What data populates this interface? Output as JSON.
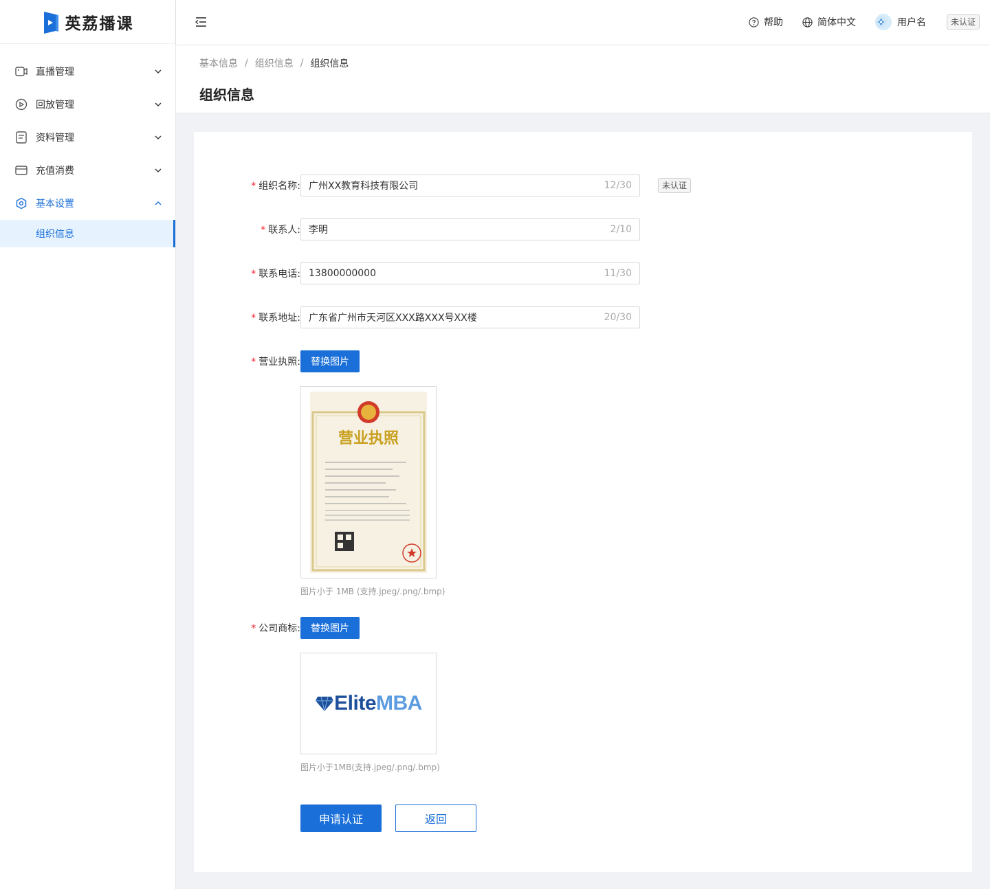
{
  "brand": {
    "name": "英荔播课"
  },
  "sidebar": {
    "items": [
      {
        "label": "直播管理",
        "icon": "video-camera-icon"
      },
      {
        "label": "回放管理",
        "icon": "replay-icon"
      },
      {
        "label": "资料管理",
        "icon": "document-icon"
      },
      {
        "label": "充值消费",
        "icon": "wallet-icon"
      },
      {
        "label": "基本设置",
        "icon": "settings-hexagon-icon"
      }
    ],
    "sub_items": [
      {
        "label": "组织信息"
      }
    ]
  },
  "header": {
    "help": "帮助",
    "language": "简体中文",
    "username": "用户名",
    "status_badge": "未认证"
  },
  "breadcrumb": [
    "基本信息",
    "组织信息",
    "组织信息"
  ],
  "page_title": "组织信息",
  "form": {
    "org_name": {
      "label": "组织名称:",
      "value": "广州XX教育科技有限公司",
      "count": "12/30",
      "badge": "未认证"
    },
    "contact": {
      "label": "联系人:",
      "value": "李明",
      "count": "2/10"
    },
    "phone": {
      "label": "联系电话:",
      "value": "13800000000",
      "count": "11/30"
    },
    "address": {
      "label": "联系地址:",
      "value": "广东省广州市天河区XXX路XXX号XX楼",
      "count": "20/30"
    },
    "license": {
      "label": "营业执照:",
      "button": "替换图片",
      "hint": "图片小于 1MB (支持.jpeg/.png/.bmp)",
      "image_title": "营业执照"
    },
    "logo": {
      "label": "公司商标:",
      "button": "替换图片",
      "hint": "图片小于1MB(支持.jpeg/.png/.bmp)",
      "logo_text_a": "Elite",
      "logo_text_b": "MBA"
    },
    "submit": "申请认证",
    "back": "返回"
  },
  "colors": {
    "primary": "#1a6fd9",
    "required": "#f5222d",
    "active_bg": "#e6f3ff"
  }
}
